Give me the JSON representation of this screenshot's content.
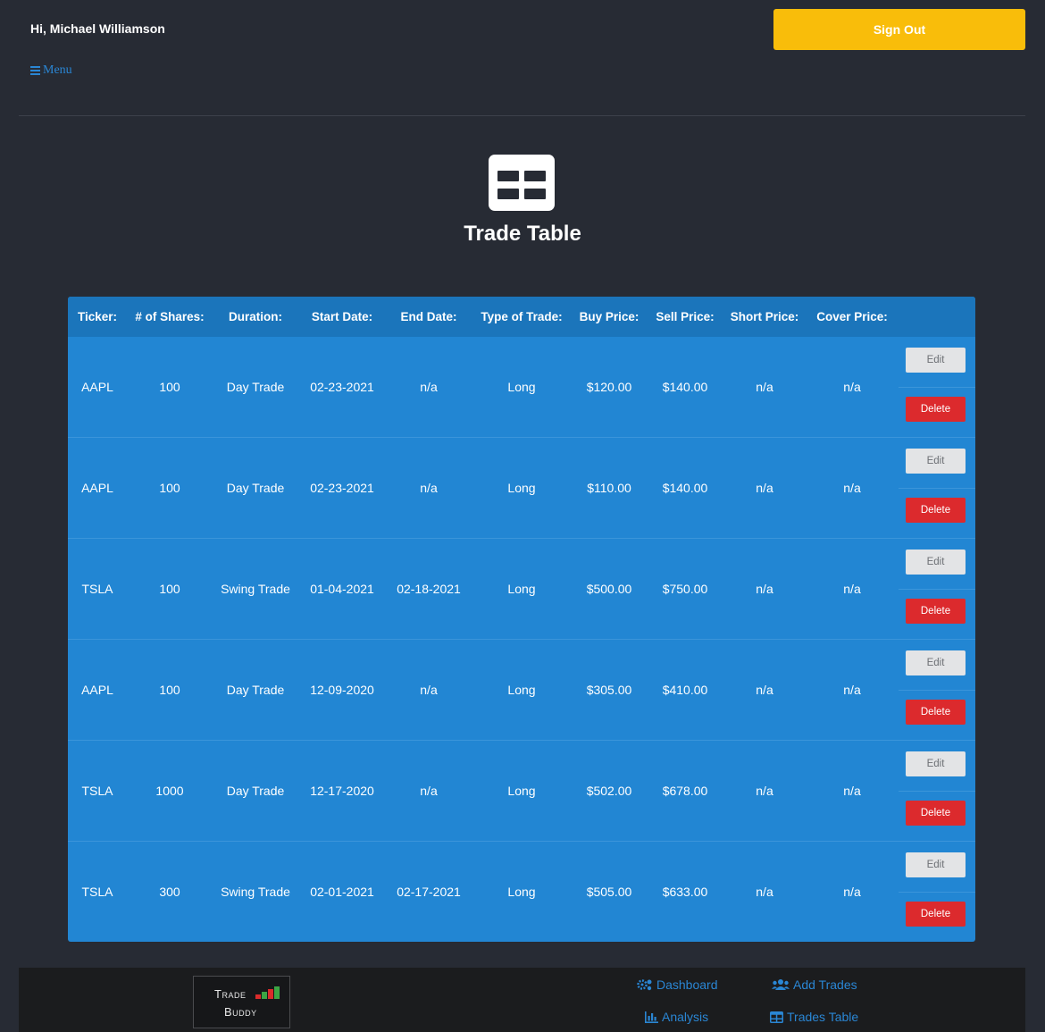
{
  "header": {
    "greeting": "Hi, Michael Williamson",
    "signout_label": "Sign Out",
    "menu_label": "Menu"
  },
  "page": {
    "title": "Trade Table",
    "icon": "table-icon"
  },
  "table": {
    "columns": [
      "Ticker:",
      "# of Shares:",
      "Duration:",
      "Start Date:",
      "End Date:",
      "Type of Trade:",
      "Buy Price:",
      "Sell Price:",
      "Short Price:",
      "Cover Price:"
    ],
    "edit_label": "Edit",
    "delete_label": "Delete",
    "rows": [
      [
        "AAPL",
        "100",
        "Day Trade",
        "02-23-2021",
        "n/a",
        "Long",
        "$120.00",
        "$140.00",
        "n/a",
        "n/a"
      ],
      [
        "AAPL",
        "100",
        "Day Trade",
        "02-23-2021",
        "n/a",
        "Long",
        "$110.00",
        "$140.00",
        "n/a",
        "n/a"
      ],
      [
        "TSLA",
        "100",
        "Swing Trade",
        "01-04-2021",
        "02-18-2021",
        "Long",
        "$500.00",
        "$750.00",
        "n/a",
        "n/a"
      ],
      [
        "AAPL",
        "100",
        "Day Trade",
        "12-09-2020",
        "n/a",
        "Long",
        "$305.00",
        "$410.00",
        "n/a",
        "n/a"
      ],
      [
        "TSLA",
        "1000",
        "Day Trade",
        "12-17-2020",
        "n/a",
        "Long",
        "$502.00",
        "$678.00",
        "n/a",
        "n/a"
      ],
      [
        "TSLA",
        "300",
        "Swing Trade",
        "02-01-2021",
        "02-17-2021",
        "Long",
        "$505.00",
        "$633.00",
        "n/a",
        "n/a"
      ]
    ]
  },
  "footer": {
    "logo": {
      "line1": "Trade",
      "line2": "Buddy"
    },
    "nav": {
      "dashboard": "Dashboard",
      "add_trades": "Add Trades",
      "analysis": "Analysis",
      "trades_table": "Trades Table"
    }
  },
  "colors": {
    "background": "#272b34",
    "accent_yellow": "#f9bd0a",
    "table_blue": "#2286d3",
    "header_blue": "#1b75bb",
    "delete_red": "#dc2a2d",
    "link_blue": "#2a86d4"
  }
}
